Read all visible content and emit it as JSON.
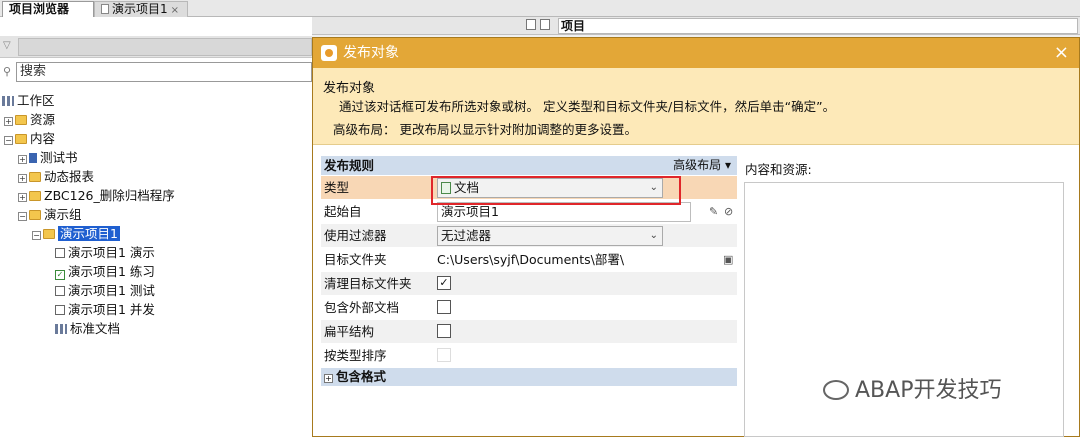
{
  "tabs": {
    "active": "项目浏览器",
    "second": "演示项目1",
    "close_glyph": "×"
  },
  "left": {
    "search_placeholder": "搜索",
    "tree": [
      {
        "label": "工作区"
      },
      {
        "label": "资源"
      },
      {
        "label": "内容"
      },
      {
        "label": "测试书"
      },
      {
        "label": "动态报表"
      },
      {
        "label": "ZBC126_删除归档程序"
      },
      {
        "label": "演示组"
      },
      {
        "label": "演示项目1"
      },
      {
        "label": "演示项目1 演示"
      },
      {
        "label": "演示项目1 练习"
      },
      {
        "label": "演示项目1 测试"
      },
      {
        "label": "演示项目1 并发"
      },
      {
        "label": "标准文档"
      }
    ]
  },
  "right_header": {
    "title": "项目"
  },
  "dialog": {
    "title": "发布对象",
    "close": "×",
    "banner": {
      "heading": "发布对象",
      "desc1": "通过该对话框可发布所选对象或树。 定义类型和目标文件夹/目标文件，然后单击“确定”。",
      "desc2": "高级布局： 更改布局以显示针对附加调整的更多设置。"
    },
    "rules": {
      "header": "发布规则",
      "advanced": "高级布局 ▾",
      "type_label": "类型",
      "type_value": "文档",
      "start_label": "起始自",
      "start_value": "演示项目1",
      "filter_label": "使用过滤器",
      "filter_value": "无过滤器",
      "target_label": "目标文件夹",
      "target_value": "C:\\Users\\syjf\\Documents\\部署\\",
      "clean_label": "清理目标文件夹",
      "include_ext_label": "包含外部文档",
      "flat_label": "扁平结构",
      "sort_label": "按类型排序",
      "include_formats": "包含格式",
      "check_glyph": "✓",
      "chev": "⌄",
      "expand": "+"
    },
    "content_label": "内容和资源:"
  },
  "watermark": "ABAP开发技巧"
}
